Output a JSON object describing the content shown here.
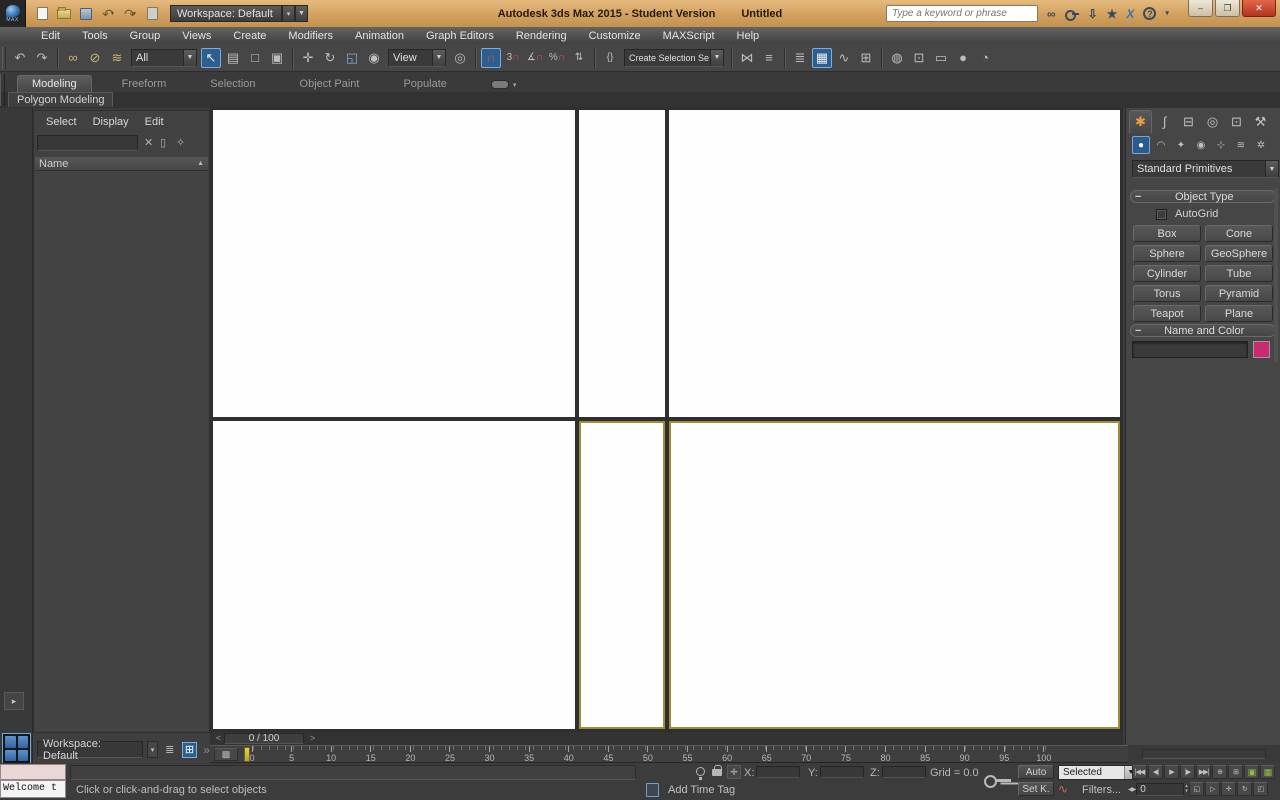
{
  "titlebar": {
    "logo_text": "MAX",
    "app_title": "Autodesk 3ds Max 2015  - Student Version",
    "doc_title": "Untitled",
    "search_placeholder": "Type a keyword or phrase"
  },
  "quick_access": {
    "workspace": "Workspace: Default"
  },
  "menu_bar": {
    "items": [
      "Edit",
      "Tools",
      "Group",
      "Views",
      "Create",
      "Modifiers",
      "Animation",
      "Graph Editors",
      "Rendering",
      "Customize",
      "MAXScript",
      "Help"
    ]
  },
  "main_toolbar": {
    "selection_filter": "All",
    "coord_system": "View",
    "named_sets_placeholder": "Create Selection Se"
  },
  "ribbon": {
    "tabs": [
      "Modeling",
      "Freeform",
      "Selection",
      "Object Paint",
      "Populate"
    ],
    "active_tab": "Modeling",
    "subtab": "Polygon Modeling"
  },
  "scene_explorer": {
    "menus": [
      "Select",
      "Display",
      "Edit"
    ],
    "column_header": "Name",
    "sort_indicator": "▲"
  },
  "workspace_bar": {
    "workspace": "Workspace: Default",
    "chevrons": "»"
  },
  "command_panel": {
    "category": "Standard Primitives",
    "object_type": {
      "title": "Object Type",
      "collapse": "−",
      "autogrid_label": "AutoGrid",
      "buttons": [
        "Box",
        "Cone",
        "Sphere",
        "GeoSphere",
        "Cylinder",
        "Tube",
        "Torus",
        "Pyramid",
        "Teapot",
        "Plane"
      ]
    },
    "name_color": {
      "title": "Name and Color",
      "collapse": "−",
      "swatch_color": "#cb2a6e"
    }
  },
  "timeline": {
    "range_display": "0 / 100",
    "prev": "<",
    "next": ">",
    "ticks": [
      "0",
      "5",
      "10",
      "15",
      "20",
      "25",
      "30",
      "35",
      "40",
      "45",
      "50",
      "55",
      "60",
      "65",
      "70",
      "75",
      "80",
      "85",
      "90",
      "95",
      "100"
    ]
  },
  "status_bar": {
    "listener_text": "Welcome t",
    "prompt": "Click or click-and-drag to select objects",
    "x_label": "X:",
    "y_label": "Y:",
    "z_label": "Z:",
    "grid_readout": "Grid = 0.0",
    "add_time_tag": "Add Time Tag",
    "auto_key": "Auto",
    "set_key": "Set K.",
    "selection_set": "Selected",
    "filters": "Filters...",
    "frame_number": "0"
  },
  "icons": {
    "undo": "↶",
    "redo": "↷",
    "link": "∞",
    "unlink": "⊘",
    "bind_spacewarp": "≋",
    "select_object": "↖",
    "select_by_name": "▤",
    "rect_region": "□",
    "window_crossing": "▣",
    "move": "✛",
    "rotate": "↻",
    "scale": "◱",
    "manipulate": "◉",
    "pivot_center": "◎",
    "snaps_toggle": "∩",
    "snap_3d": "3",
    "angle_snap": "∡",
    "percent_snap": "%",
    "spinner_snap": "⇅",
    "named_sets": "{}",
    "mirror": "⋈",
    "align": "≡",
    "layers": "≣",
    "ribbon_toggle": "▦",
    "curve_editor": "∿",
    "schematic": "⊞",
    "material_editor": "◍",
    "render_setup": "⊡",
    "rendered_frame": "▭",
    "render": "●",
    "render_last": "◔",
    "combo_arrow": "▼",
    "small_arrow": "▾",
    "binoculars": "∞",
    "signin_arrow": "⇩",
    "star": "★",
    "exchange": "X",
    "help": "?",
    "win_min": "–",
    "win_restore": "❐",
    "win_close": "✕",
    "cmd_create": "✱",
    "cmd_modify": "∫",
    "cmd_hierarchy": "⊟",
    "cmd_motion": "◎",
    "cmd_display": "⊡",
    "cmd_utilities": "⚒",
    "sub_geometry": "●",
    "sub_shapes": "◠",
    "sub_lights": "✦",
    "sub_cameras": "◉",
    "sub_helpers": "⊹",
    "sub_spacewarps": "≋",
    "sub_systems": "✲",
    "clear_search": "✕",
    "explorer_display": "▯",
    "explorer_filter": "✧",
    "strip_arrow": "▸",
    "mini_curve": "▩",
    "play_start": "|◀◀",
    "play_prev": "◀|",
    "play": "▶",
    "play_next": "|▶",
    "play_end": "▶▶|",
    "key_mode": "◀▶",
    "nav_zoom": "⊕",
    "nav_zoom_all": "⊞",
    "nav_extents": "▣",
    "nav_extents_all": "▦",
    "nav_region": "◱",
    "nav_fov": "▷",
    "nav_pan": "✛",
    "nav_orbit": "↻",
    "nav_maximize": "◰",
    "xyz_toggle": "✛",
    "filter_curve": "∿",
    "spin_up": "▴",
    "spin_down": "▾",
    "ws_layers": "≣",
    "ws_explorer_toggle": "⊞"
  }
}
